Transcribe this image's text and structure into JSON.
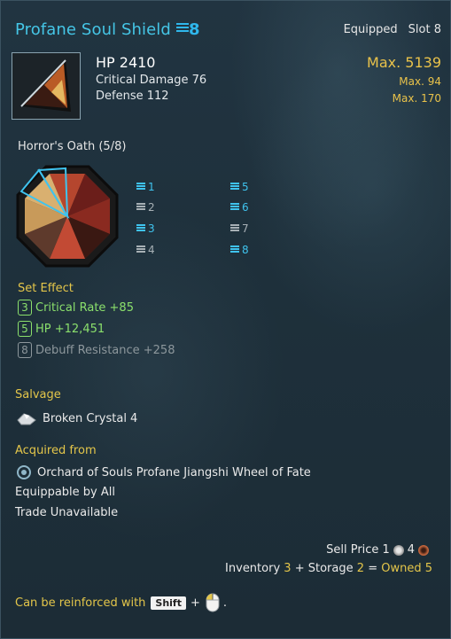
{
  "item": {
    "name": "Profane Soul Shield",
    "upgrade": "8",
    "status": "Equipped",
    "slot": "Slot 8",
    "hp": "HP 2410",
    "crit_damage": "Critical Damage 76",
    "defense": "Defense 112",
    "max_hp": "Max. 5139",
    "max_crit": "Max. 94",
    "max_def": "Max. 170"
  },
  "set": {
    "name": "Horror's Oath (5/8)",
    "slots": [
      {
        "label": "1",
        "active": true
      },
      {
        "label": "2",
        "active": false
      },
      {
        "label": "3",
        "active": true
      },
      {
        "label": "4",
        "active": false
      },
      {
        "label": "5",
        "active": true
      },
      {
        "label": "6",
        "active": true
      },
      {
        "label": "7",
        "active": false
      },
      {
        "label": "8",
        "active": true
      }
    ],
    "effect_label": "Set Effect",
    "effects": [
      {
        "count": "3",
        "text": "Critical Rate +85",
        "active": true
      },
      {
        "count": "5",
        "text": "HP +12,451",
        "active": true
      },
      {
        "count": "8",
        "text": "Debuff Resistance +258",
        "active": false
      }
    ]
  },
  "salvage": {
    "label": "Salvage",
    "item": "Broken Crystal 4"
  },
  "acquired": {
    "label": "Acquired from",
    "source": "Orchard of Souls Profane Jiangshi Wheel of Fate",
    "equippable": "Equippable by All",
    "trade": "Trade Unavailable"
  },
  "price": {
    "label": "Sell Price",
    "silver": "1",
    "copper": "4"
  },
  "inventory": {
    "inv_label": "Inventory",
    "inv_count": "3",
    "plus": "+",
    "storage_label": "Storage",
    "storage_count": "2",
    "equals": "=",
    "owned": "Owned 5"
  },
  "reinforce": {
    "text": "Can be reinforced with",
    "key": "Shift",
    "plus": "+",
    "end": "."
  },
  "colors": {
    "accent": "#45c6e6",
    "gold": "#e4c64a",
    "active_effect": "#8be06c",
    "inactive": "#8d979c"
  }
}
